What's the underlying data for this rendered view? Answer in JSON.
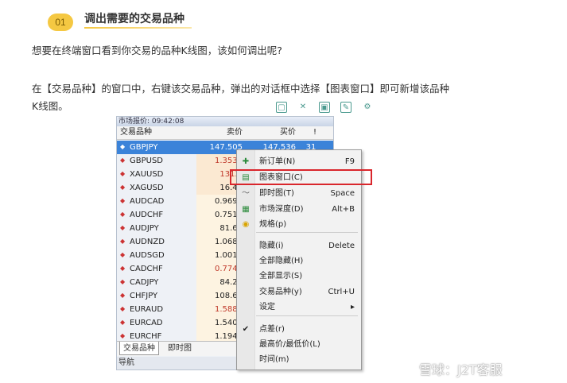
{
  "heading": {
    "step": "01",
    "title": "调出需要的交易品种"
  },
  "paragraphs": [
    "想要在终端窗口看到你交易的品种K线图，该如何调出呢?",
    "在【交易品种】的窗口中，右键该交易品种，弹出的对话框中选择【图表窗口】即可新增该品种",
    "K线图。"
  ],
  "window": {
    "title": "市场报价: 09:42:08",
    "columns": {
      "symbol": "交易品种",
      "bid": "卖价",
      "ask": "买价",
      "spread": "!"
    },
    "rows": [
      {
        "symbol": "GBPJPY",
        "bid": "147.505",
        "ask": "147.536",
        "spread": "31"
      },
      {
        "symbol": "GBPUSD",
        "bid": "1.3537",
        "ask": "",
        "spread": ""
      },
      {
        "symbol": "XAUUSD",
        "bid": "1313.",
        "ask": "",
        "spread": ""
      },
      {
        "symbol": "XAGUSD",
        "bid": "16.48",
        "ask": "",
        "spread": ""
      },
      {
        "symbol": "AUDCAD",
        "bid": "0.9698",
        "ask": "",
        "spread": ""
      },
      {
        "symbol": "AUDCHF",
        "bid": "0.7514",
        "ask": "",
        "spread": ""
      },
      {
        "symbol": "AUDJPY",
        "bid": "81.67",
        "ask": "",
        "spread": ""
      },
      {
        "symbol": "AUDNZD",
        "bid": "1.0687",
        "ask": "",
        "spread": ""
      },
      {
        "symbol": "AUDSGD",
        "bid": "1.0018",
        "ask": "",
        "spread": ""
      },
      {
        "symbol": "CADCHF",
        "bid": "0.7746",
        "ask": "",
        "spread": ""
      },
      {
        "symbol": "CADJPY",
        "bid": "84.20",
        "ask": "",
        "spread": ""
      },
      {
        "symbol": "CHFJPY",
        "bid": "108.66",
        "ask": "",
        "spread": ""
      },
      {
        "symbol": "EURAUD",
        "bid": "1.5885",
        "ask": "",
        "spread": ""
      },
      {
        "symbol": "EURCAD",
        "bid": "1.5409",
        "ask": "",
        "spread": ""
      },
      {
        "symbol": "EURCHF",
        "bid": "1.1940",
        "ask": "",
        "spread": ""
      }
    ],
    "tabs": [
      "交易品种",
      "即时图"
    ],
    "navigator": "导航"
  },
  "menu": {
    "items": [
      {
        "label": "新订单(N)",
        "shortcut": "F9",
        "icon": "new-order-icon"
      },
      {
        "label": "图表窗口(C)",
        "shortcut": "",
        "icon": "chart-window-icon"
      },
      {
        "label": "即时图(T)",
        "shortcut": "Space",
        "icon": "tick-chart-icon"
      },
      {
        "label": "市场深度(D)",
        "shortcut": "Alt+B",
        "icon": "market-depth-icon"
      },
      {
        "label": "规格(p)",
        "shortcut": "",
        "icon": "specification-icon"
      },
      {
        "label": "隐藏(i)",
        "shortcut": "Delete",
        "icon": ""
      },
      {
        "label": "全部隐藏(H)",
        "shortcut": "",
        "icon": ""
      },
      {
        "label": "全部显示(S)",
        "shortcut": "",
        "icon": ""
      },
      {
        "label": "交易品种(y)",
        "shortcut": "Ctrl+U",
        "icon": ""
      },
      {
        "label": "设定",
        "shortcut": "▸",
        "icon": ""
      },
      {
        "label": "点差(r)",
        "shortcut": "",
        "icon": "check-icon"
      },
      {
        "label": "最高价/最低价(L)",
        "shortcut": "",
        "icon": ""
      },
      {
        "label": "时间(m)",
        "shortcut": "",
        "icon": ""
      }
    ]
  },
  "watermark": "雪球：J2T客服",
  "colors": {
    "accent": "#f5c842",
    "selection": "#3b83d9",
    "highlight": "#d9262c"
  }
}
